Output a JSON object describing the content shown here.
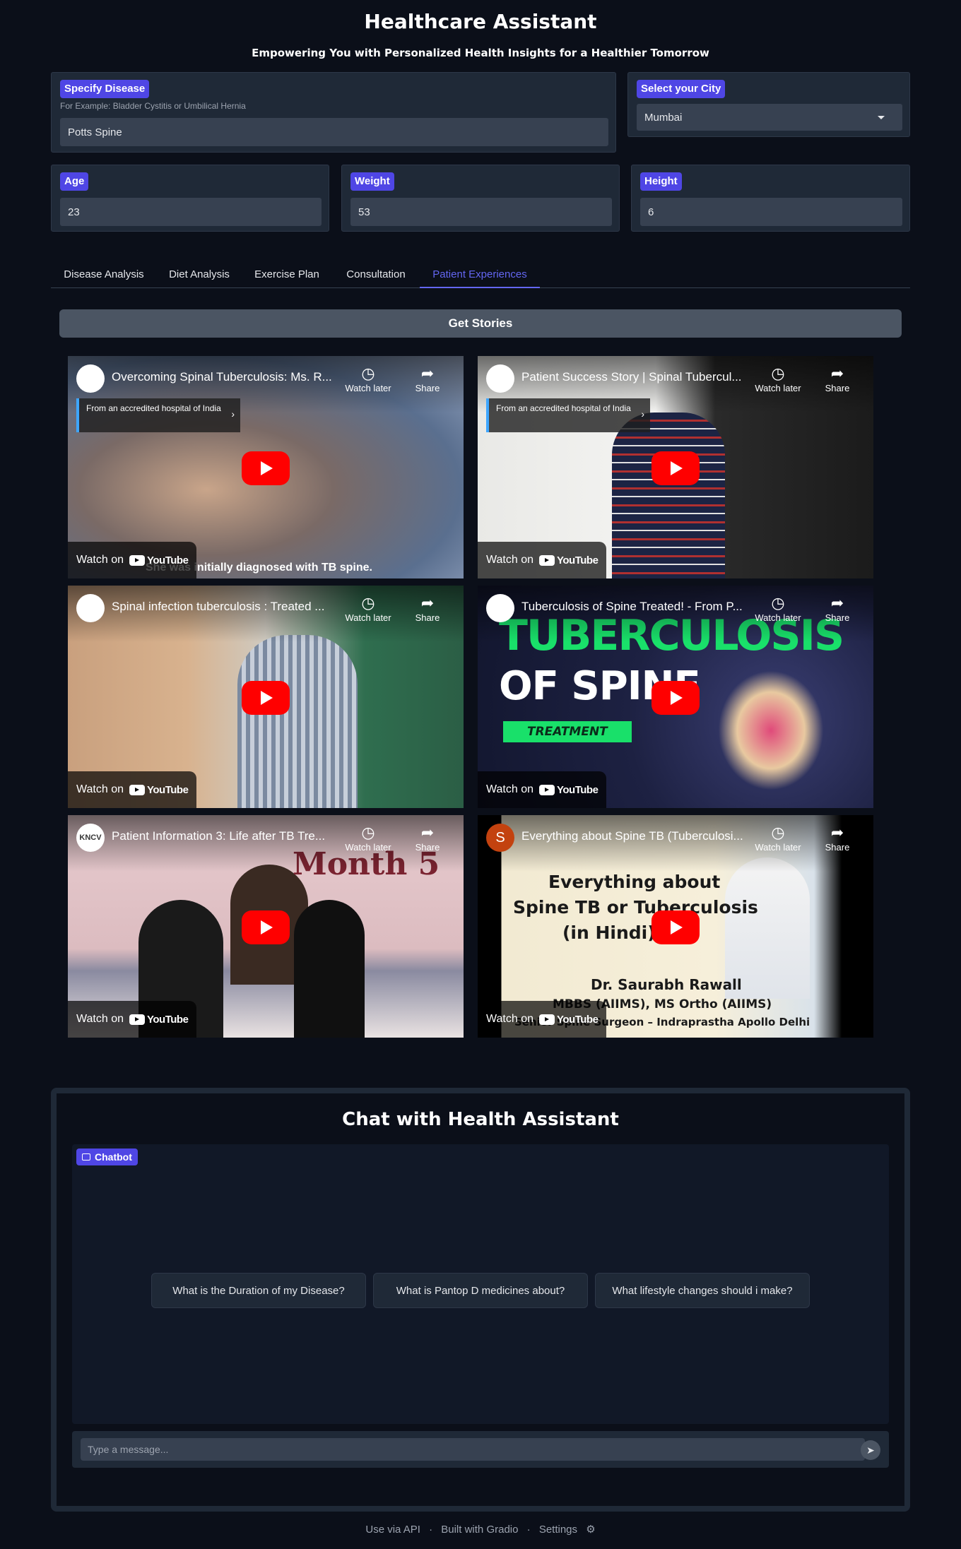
{
  "header": {
    "title": "Healthcare Assistant",
    "subtitle": "Empowering You with Personalized Health Insights for a Healthier Tomorrow"
  },
  "form": {
    "disease": {
      "label": "Specify Disease",
      "hint": "For Example: Bladder Cystitis or Umbilical Hernia",
      "value": "Potts Spine"
    },
    "city": {
      "label": "Select your City",
      "value": "Mumbai"
    },
    "age": {
      "label": "Age",
      "value": "23"
    },
    "weight": {
      "label": "Weight",
      "value": "53"
    },
    "height": {
      "label": "Height",
      "value": "6"
    }
  },
  "tabs": [
    {
      "label": "Disease Analysis"
    },
    {
      "label": "Diet Analysis"
    },
    {
      "label": "Exercise Plan"
    },
    {
      "label": "Consultation"
    },
    {
      "label": "Patient Experiences",
      "active": true
    }
  ],
  "stories_button": "Get Stories",
  "video_common": {
    "watch_later": "Watch later",
    "share": "Share",
    "watch_on": "Watch on",
    "youtube": "YouTube",
    "accredited": "From an accredited hospital of India"
  },
  "videos": [
    {
      "title": "Overcoming Spinal Tuberculosis: Ms. R...",
      "caption": "She was initially diagnosed with TB spine."
    },
    {
      "title": "Patient Success Story | Spinal Tubercul..."
    },
    {
      "title": "Spinal infection tuberculosis : Treated ..."
    },
    {
      "title": "Tuberculosis of Spine Treated! - From P...",
      "thumb_line1": "TUBERCULOSIS",
      "thumb_line2": "OF SPINE",
      "thumb_tag": "TREATMENT"
    },
    {
      "title": "Patient Information 3: Life after TB Tre...",
      "avatar": "KNCV",
      "thumb_text": "Month 5"
    },
    {
      "title": "Everything about Spine TB (Tuberculosi...",
      "avatar": "S",
      "thumb_line1": "Everything about",
      "thumb_line2": "Spine TB or Tuberculosis",
      "thumb_line3": "(in Hindi)",
      "thumb_line4": "Dr. Saurabh Rawall",
      "thumb_line5": "MBBS (AIIMS), MS Ortho (AIIMS)",
      "thumb_line6": "Senior Spine Surgeon – Indraprastha Apollo Delhi"
    }
  ],
  "chat": {
    "title": "Chat with Health Assistant",
    "badge": "Chatbot",
    "examples": [
      "What is the Duration of my Disease?",
      "What is Pantop D medicines about?",
      "What lifestyle changes should i make?"
    ],
    "placeholder": "Type a message..."
  },
  "footer": {
    "api": "Use via API",
    "built": "Built with Gradio",
    "settings": "Settings"
  },
  "colors": {
    "background": "#0b0f19",
    "panel": "#1f2937",
    "accent": "#4f46e5",
    "active_tab": "#6366f1",
    "youtube_red": "#ff0000"
  }
}
